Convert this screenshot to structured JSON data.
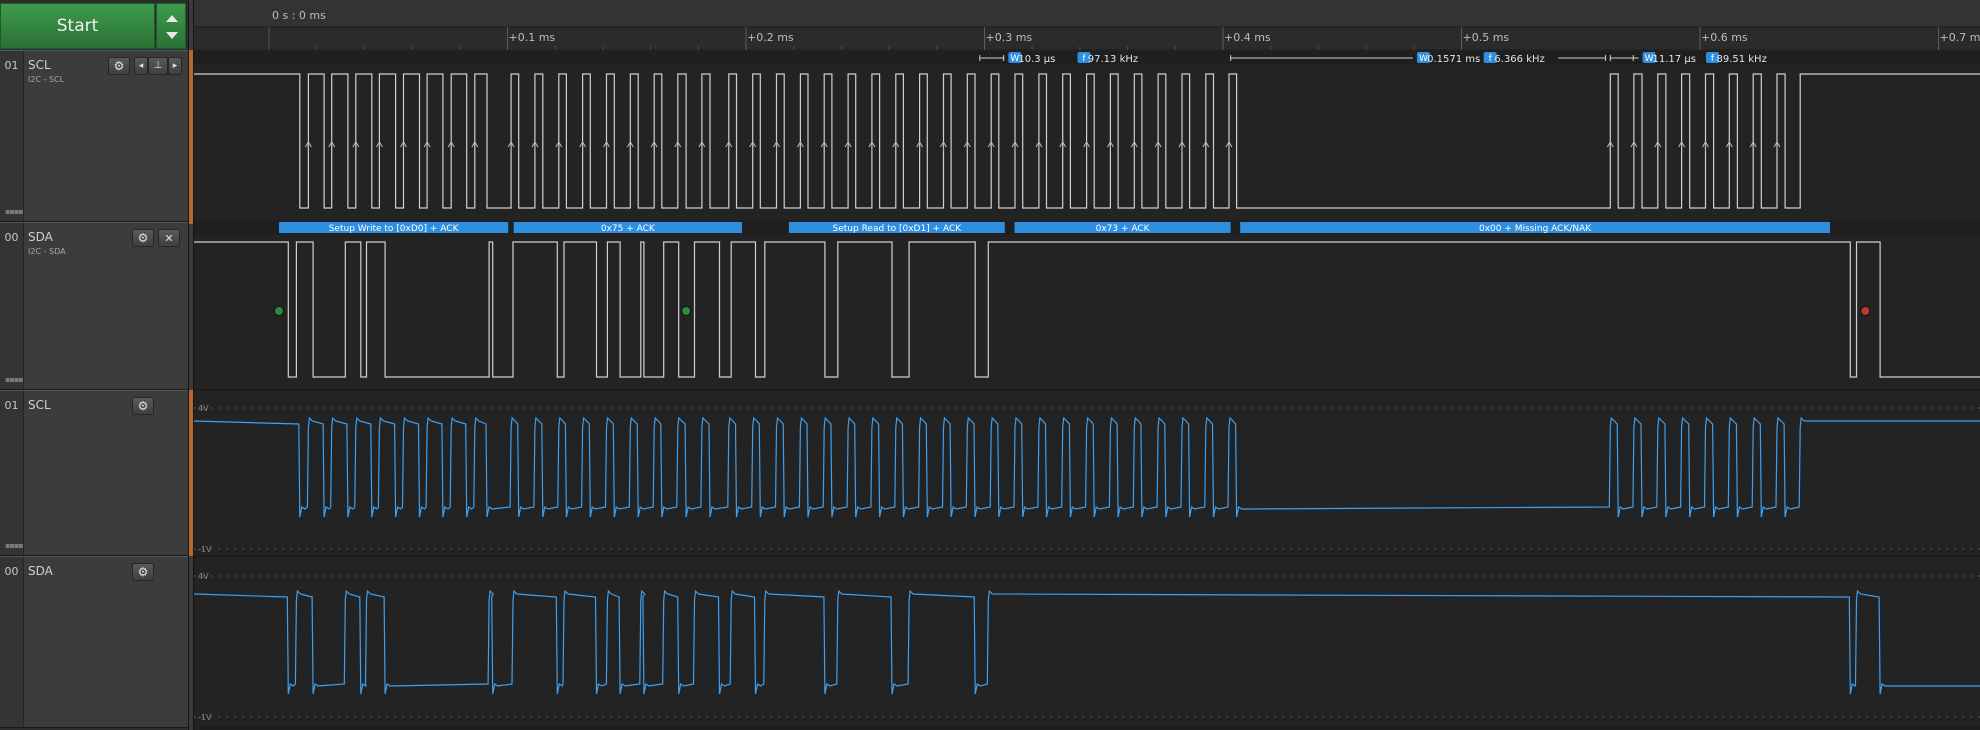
{
  "toolbar": {
    "start_label": "Start"
  },
  "timeline": {
    "cursor_label": "0 s : 0 ms",
    "ticks": [
      "+0.1 ms",
      "+0.2 ms",
      "+0.3 ms",
      "+0.4 ms",
      "+0.5 ms",
      "+0.6 ms",
      "+0.7 ms"
    ]
  },
  "channels": [
    {
      "index": "01",
      "name": "SCL",
      "subtitle": "I2C - SCL"
    },
    {
      "index": "00",
      "name": "SDA",
      "subtitle": "I2C - SDA"
    },
    {
      "index": "01",
      "name": "SCL"
    },
    {
      "index": "00",
      "name": "SDA"
    }
  ],
  "measurements": [
    {
      "w_icon": "W",
      "width": "10.3 μs",
      "f_icon": "f",
      "freq": "97.13 kHz"
    },
    {
      "w_icon": "W",
      "width": "0.1571 ms",
      "f_icon": "f",
      "freq": "6.366 kHz"
    },
    {
      "w_icon": "W",
      "width": "11.17 μs",
      "f_icon": "f",
      "freq": "89.51 kHz"
    }
  ],
  "decoded_frames": [
    "Setup Write to [0xD0] + ACK",
    "0x75 + ACK",
    "Setup Read to [0xD1] + ACK",
    "0x73 + ACK",
    "0x00 + Missing ACK/NAK"
  ],
  "analog_scale": {
    "top": "4V",
    "bottom": "-1V"
  },
  "colors": {
    "accent_blue": "#2e8fe0",
    "digital_trace": "#d0d0d0",
    "analog_trace": "#3ea0ee",
    "marker_start": "#2f8a3a",
    "marker_stop": "#c0392b",
    "start_button": "#3d9a4a"
  },
  "icons": [
    "gear-icon",
    "arrow-left-icon",
    "trigger-icon",
    "arrow-right-icon",
    "close-icon"
  ]
}
